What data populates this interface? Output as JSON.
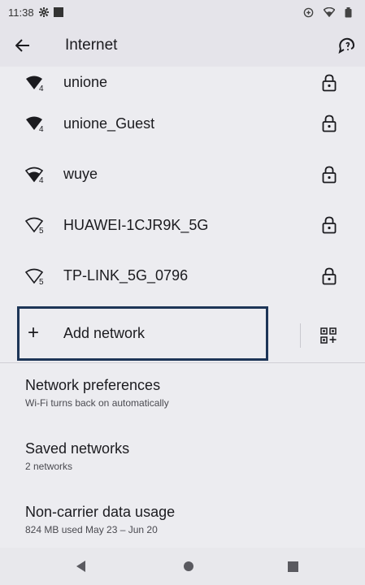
{
  "status_bar": {
    "time": "11:38"
  },
  "app_bar": {
    "title": "Internet"
  },
  "networks": [
    {
      "ssid": "unione",
      "band": "4"
    },
    {
      "ssid": "unione_Guest",
      "band": "4"
    },
    {
      "ssid": "wuye",
      "band": "4"
    },
    {
      "ssid": "HUAWEI-1CJR9K_5G",
      "band": "5"
    },
    {
      "ssid": "TP-LINK_5G_0796",
      "band": "5"
    }
  ],
  "add_network": {
    "plus": "+",
    "label": "Add network"
  },
  "preferences": [
    {
      "title": "Network preferences",
      "subtitle": "Wi-Fi turns back on automatically"
    },
    {
      "title": "Saved networks",
      "subtitle": "2 networks"
    },
    {
      "title": "Non-carrier data usage",
      "subtitle": "824 MB used May 23 – Jun 20"
    }
  ],
  "colors": {
    "highlight_box": "#1d3557",
    "background": "#ececf0",
    "bar": "#e5e4ea"
  }
}
